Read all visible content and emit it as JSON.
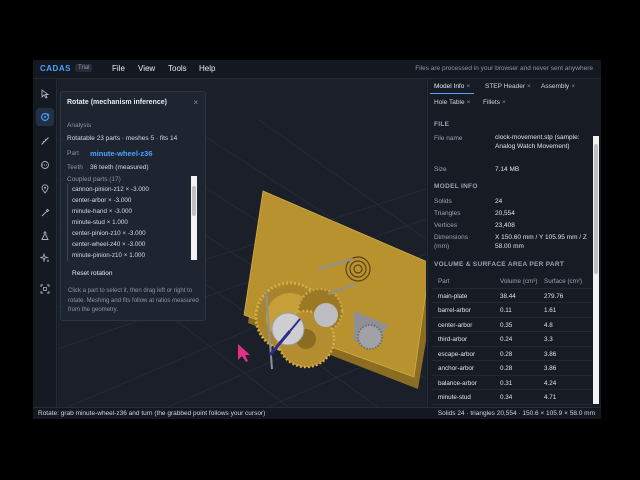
{
  "topbar": {
    "brand": "CADAS",
    "badge": "Trial",
    "menus": [
      "File",
      "View",
      "Tools",
      "Help"
    ],
    "notice": "Files are processed in your browser and never sent anywhere"
  },
  "toolbar": {
    "tools": [
      "select-cursor-icon",
      "rotate-mechanism-icon",
      "measure-ruler-icon",
      "section-view-icon",
      "pin-marker-icon",
      "eyedropper-icon",
      "flask-icon",
      "sparkle-icon",
      "fit-view-icon"
    ]
  },
  "rotate_panel": {
    "title": "Rotate (mechanism inference)",
    "close": "×",
    "analysis_label": "Analysis",
    "analysis_value": "Rotatable 23 parts · meshes 5 · fits 14",
    "part_label": "Part",
    "part_value": "minute-wheel-z36",
    "teeth_label": "Teeth",
    "teeth_value": "36 teeth (measured)",
    "coupled_label": "Coupled parts (17)",
    "coupled": [
      "cannon-pinion-z12 × -3.000",
      "center-arbor × -3.000",
      "minute-hand × -3.000",
      "minute-stud × 1.000",
      "center-pinion-z10 × -3.000",
      "center-wheel-z40 × -3.000",
      "minute-pinion-z10 × 1.000"
    ],
    "reset_label": "Reset rotation",
    "hint": "Click a part to select it, then drag left or right to rotate. Meshing and fits follow at ratios measured from the geometry."
  },
  "right_panel": {
    "tabs_row1": [
      {
        "label": "Model Info",
        "close": "×"
      },
      {
        "label": "STEP Header",
        "close": "×"
      },
      {
        "label": "Assembly",
        "close": "×"
      }
    ],
    "tabs_row2": [
      {
        "label": "Hole Table",
        "close": "×"
      },
      {
        "label": "Fillets",
        "close": "×"
      }
    ],
    "file_heading": "FILE",
    "file_name_label": "File name",
    "file_name_value": "clock-movement.stp (sample: Analog Watch Movement)",
    "size_label": "Size",
    "size_value": "7.14 MB",
    "model_heading": "MODEL INFO",
    "solids_label": "Solids",
    "solids_value": "24",
    "triangles_label": "Triangles",
    "triangles_value": "20,554",
    "vertices_label": "Vertices",
    "vertices_value": "23,408",
    "dims_label": "Dimensions (mm)",
    "dims_value": "X 150.60 mm / Y 105.95 mm / Z 58.00 mm",
    "volume_heading": "VOLUME & SURFACE AREA PER PART",
    "table_head": {
      "part": "Part",
      "volume": "Volume (cm³)",
      "surface": "Surface (cm²)"
    },
    "rows": [
      {
        "part": "main-plate",
        "volume": "38.44",
        "surface": "279.76"
      },
      {
        "part": "barrel-arbor",
        "volume": "0.11",
        "surface": "1.61"
      },
      {
        "part": "center-arbor",
        "volume": "0.35",
        "surface": "4.8"
      },
      {
        "part": "third-arbor",
        "volume": "0.24",
        "surface": "3.3"
      },
      {
        "part": "escape-arbor",
        "volume": "0.28",
        "surface": "3.86"
      },
      {
        "part": "anchor-arbor",
        "volume": "0.28",
        "surface": "3.86"
      },
      {
        "part": "balance-arbor",
        "volume": "0.31",
        "surface": "4.24"
      },
      {
        "part": "minute-stud",
        "volume": "0.34",
        "surface": "4.71"
      }
    ]
  },
  "status": {
    "left": "Rotate: grab minute-wheel-z36 and turn (the grabbed point follows your cursor)",
    "right": "Solids 24 · triangles 20,554 · 150.6 × 105.9 × 58.0 mm"
  },
  "colors": {
    "accent": "#4aa3ff",
    "plate": "#b8922e",
    "cursor": "#e0318a"
  }
}
